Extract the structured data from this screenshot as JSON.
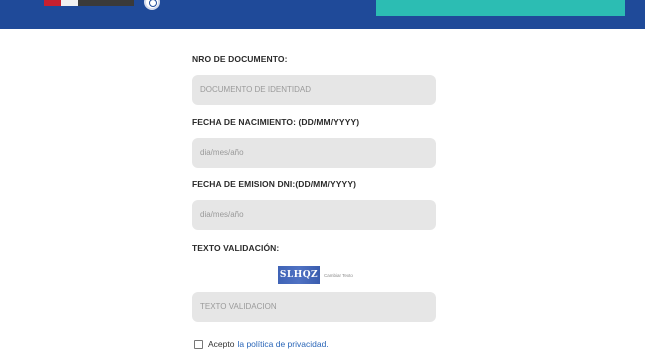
{
  "colors": {
    "header": "#1f4a99",
    "accent": "#2cbdb3",
    "field_bg": "#e6e6e6",
    "link": "#2a66b8"
  },
  "form": {
    "document": {
      "label": "NRO DE DOCUMENTO:",
      "placeholder": "DOCUMENTO DE IDENTIDAD"
    },
    "birth_date": {
      "label": "FECHA DE NACIMIENTO: (DD/MM/YYYY)",
      "placeholder": "dia/mes/año"
    },
    "issue_date": {
      "label": "FECHA DE EMISION DNI:(DD/MM/YYYY)",
      "placeholder": "dia/mes/año"
    },
    "validation": {
      "label": "TEXTO VALIDACIÓN:",
      "captcha_text": "SLHQZ",
      "refresh_link": "Cambiar Texto",
      "placeholder": "TEXTO VALIDACION"
    },
    "privacy": {
      "prefix": "Acepto",
      "link": "la política de privacidad."
    }
  }
}
